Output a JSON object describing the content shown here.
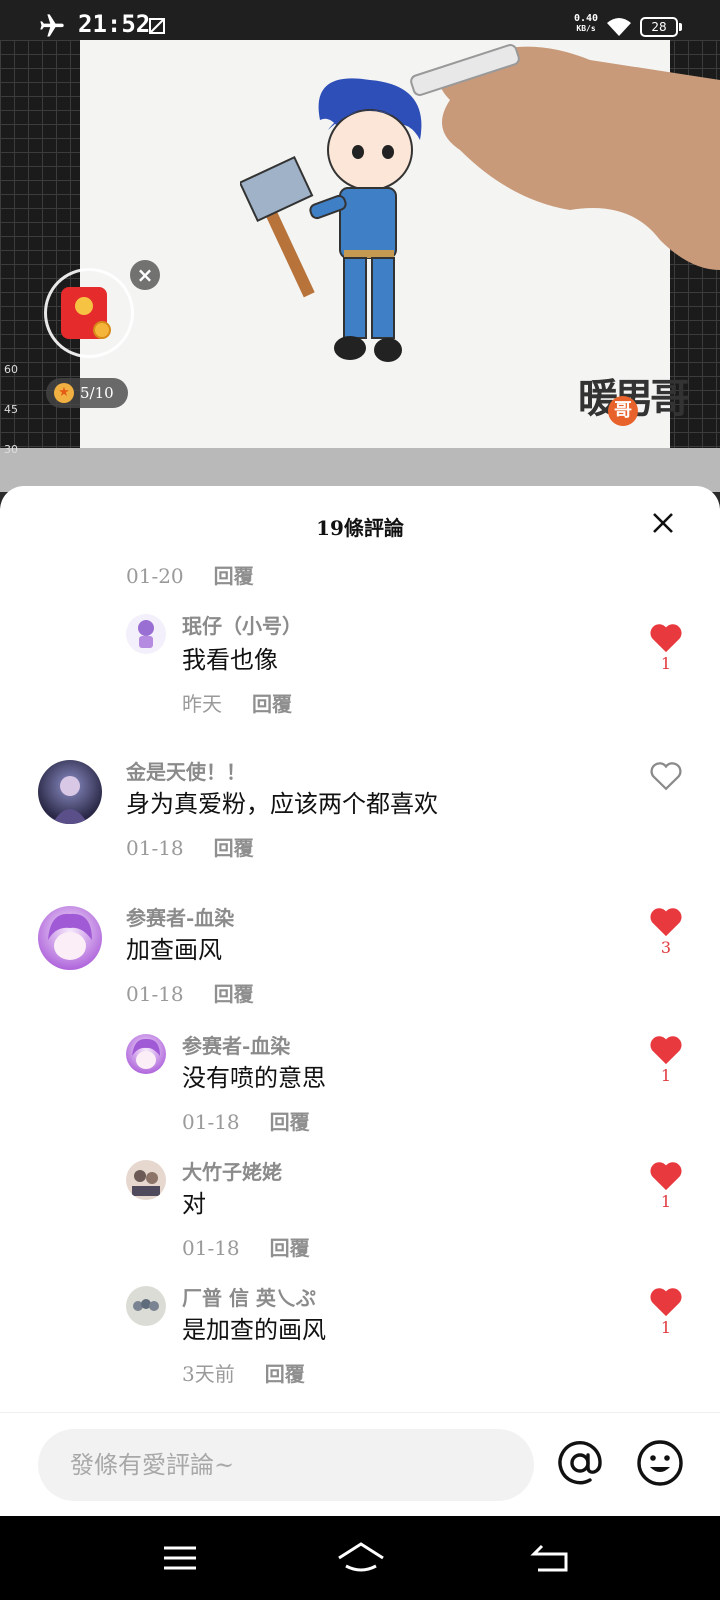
{
  "status_bar": {
    "time": "21:52",
    "net_speed_value": "0.40",
    "net_speed_unit": "KB/s",
    "battery": "28",
    "icons": [
      "airplane-mode-icon",
      "screenshot-icon",
      "wifi-icon",
      "battery-icon"
    ]
  },
  "video": {
    "watermark": "暖男哥",
    "watermark_badge": "哥",
    "ruler_marks": [
      "60",
      "45",
      "30"
    ],
    "task_progress": "5/10"
  },
  "sheet": {
    "title": "19條評論"
  },
  "comments": [
    {
      "meta_time": "01-20",
      "meta_reply": "回覆"
    },
    {
      "name": "珉仔（小号）",
      "text": "我看也像",
      "time": "昨天",
      "reply": "回覆",
      "likes": "1",
      "liked": true
    },
    {
      "name": "金是天使！！",
      "text": "身为真爱粉，应该两个都喜欢",
      "time": "01-18",
      "reply": "回覆",
      "likes": "",
      "liked": false
    },
    {
      "name": "参赛者-血染",
      "text": "加查画风",
      "time": "01-18",
      "reply": "回覆",
      "likes": "3",
      "liked": true
    },
    {
      "name": "参赛者-血染",
      "text": "没有喷的意思",
      "time": "01-18",
      "reply": "回覆",
      "likes": "1",
      "liked": true
    },
    {
      "name": "大竹子姥姥",
      "text": "对",
      "time": "01-18",
      "reply": "回覆",
      "likes": "1",
      "liked": true
    },
    {
      "name": "厂普 信 英乀ぷ",
      "text": "是加查的画风",
      "time": "3天前",
      "reply": "回覆",
      "likes": "1",
      "liked": true
    }
  ],
  "input": {
    "placeholder": "發條有愛評論~"
  },
  "colors": {
    "like_red": "#e8393e",
    "sheet_bg": "#ffffff",
    "input_bg": "#f2f2f2"
  }
}
